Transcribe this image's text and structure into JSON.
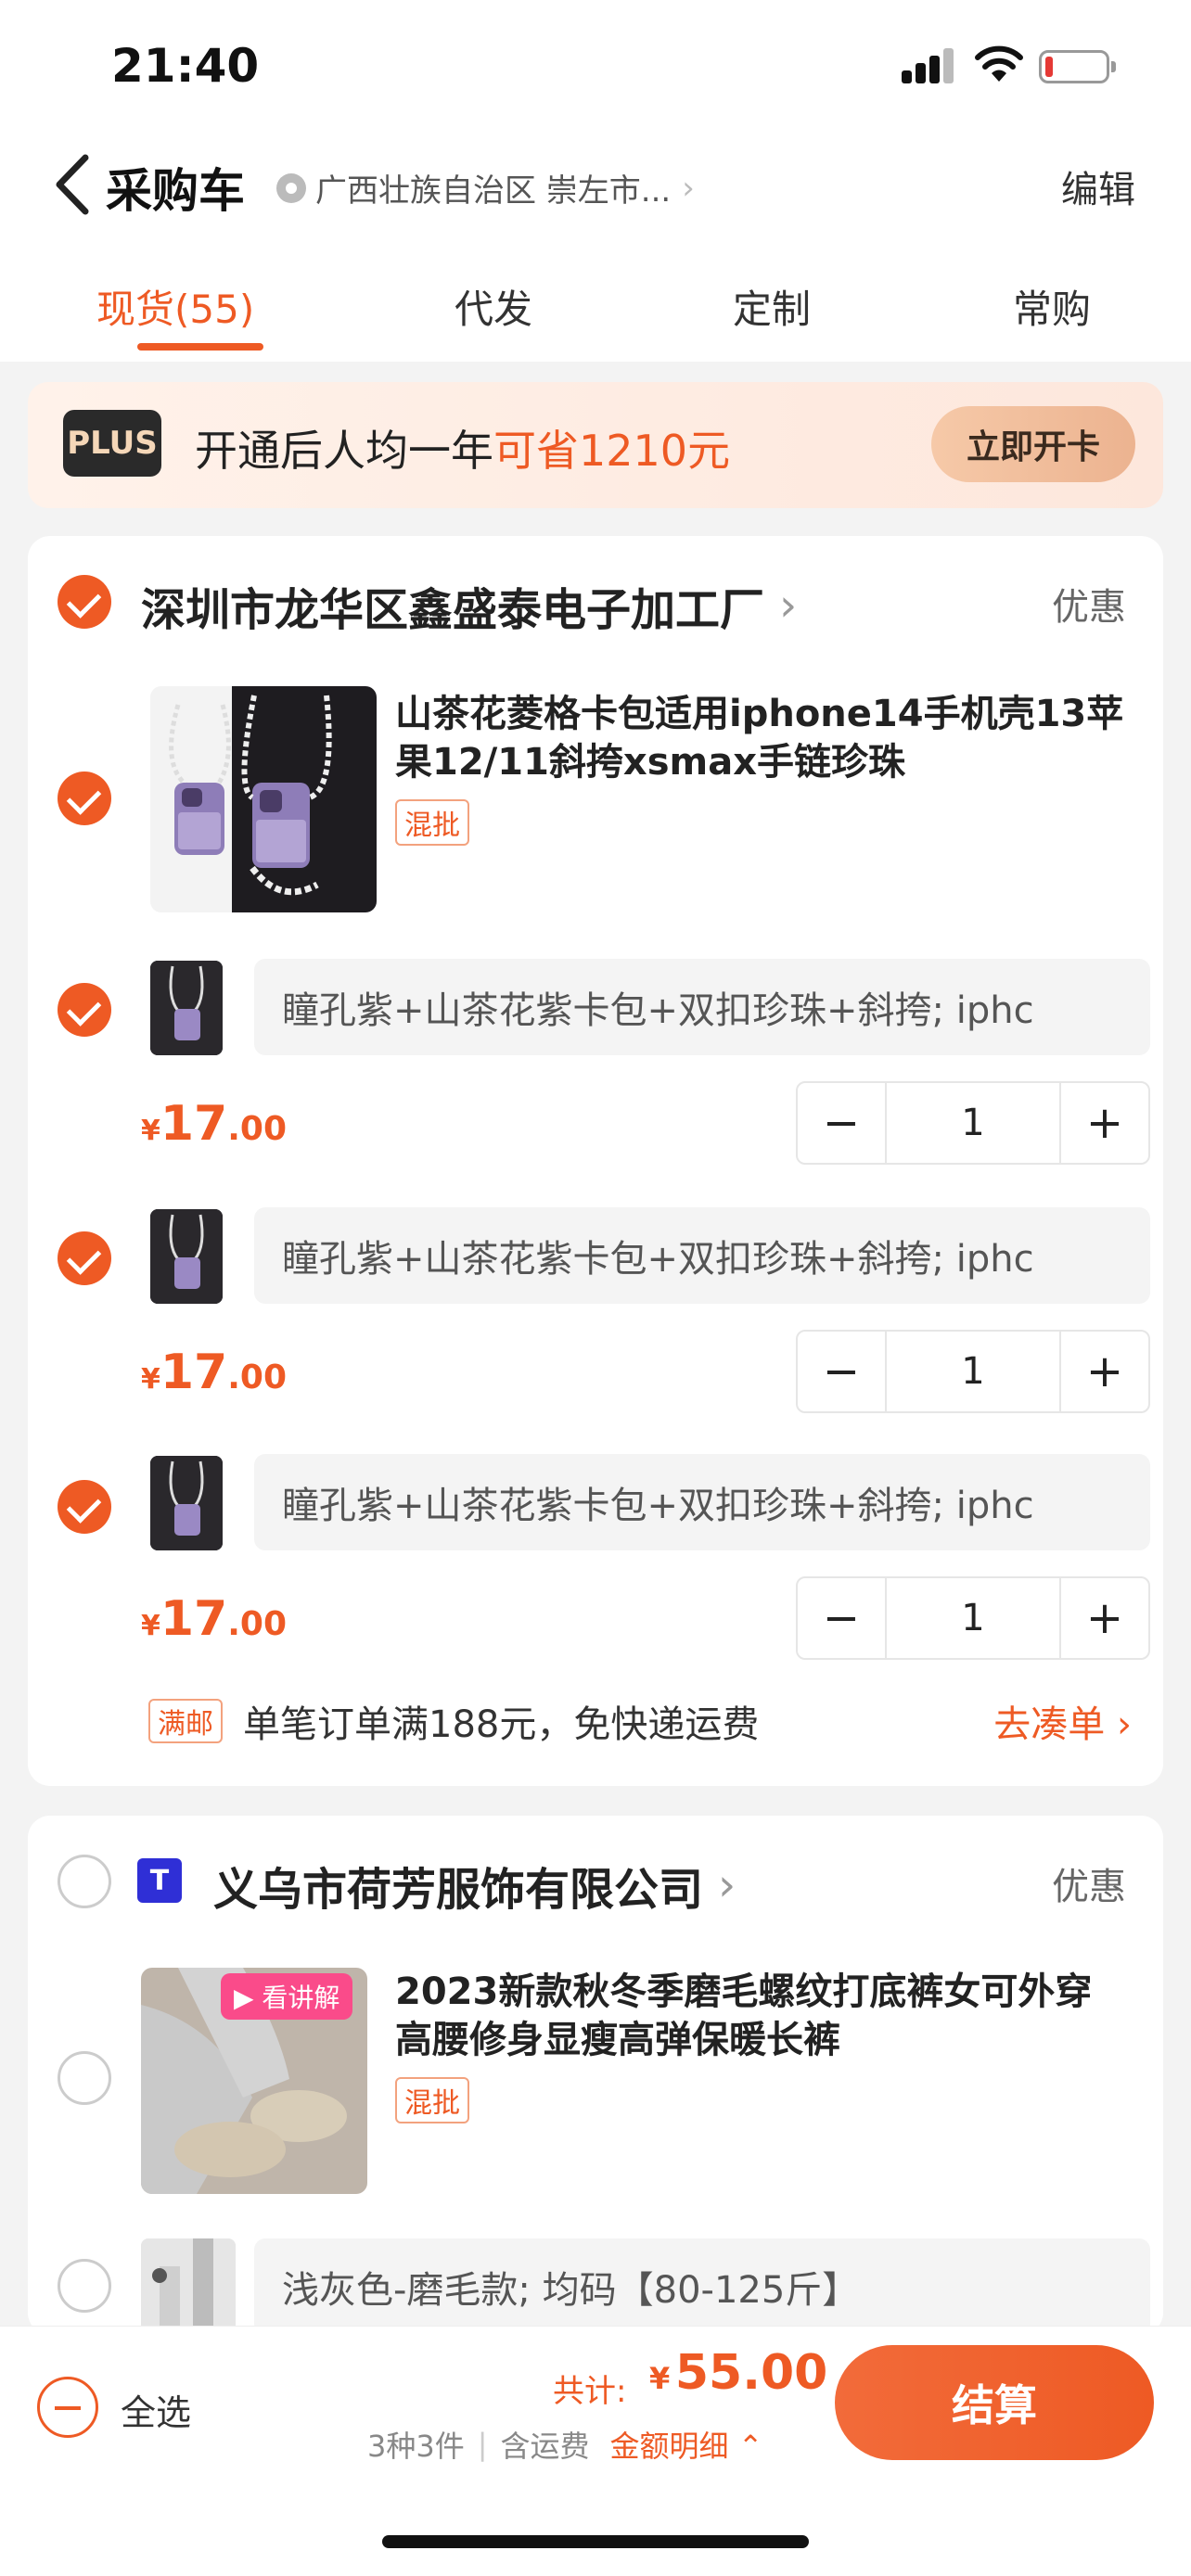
{
  "status_bar": {
    "time": "21:40"
  },
  "nav": {
    "title": "采购车",
    "location": "广西壮族自治区 崇左市...",
    "edit": "编辑"
  },
  "tabs": [
    "现货(55)",
    "代发",
    "定制",
    "常购"
  ],
  "plus_banner": {
    "badge": "PLUS",
    "text_prefix": "开通后人均一年",
    "text_highlight": "可省1210元",
    "button": "立即开卡"
  },
  "shop1": {
    "name": "深圳市龙华区鑫盛泰电子加工厂",
    "promo": "优惠",
    "product": {
      "title": "山茶花菱格卡包适用iphone14手机壳13苹果12/11斜挎xsmax手链珍珠",
      "tag": "混批"
    },
    "variants": [
      {
        "spec": "瞳孔紫+山茶花紫卡包+双扣珍珠+斜挎; iphc",
        "price_int": "17",
        "price_dec": ".00",
        "qty": "1"
      },
      {
        "spec": "瞳孔紫+山茶花紫卡包+双扣珍珠+斜挎; iphc",
        "price_int": "17",
        "price_dec": ".00",
        "qty": "1"
      },
      {
        "spec": "瞳孔紫+山茶花紫卡包+双扣珍珠+斜挎; iphc",
        "price_int": "17",
        "price_dec": ".00",
        "qty": "1"
      }
    ],
    "shipping": {
      "tag": "满邮",
      "text": "单笔订单满188元，免快递运费",
      "link": "去凑单 ›"
    }
  },
  "shop2": {
    "name": "义乌市荷芳服饰有限公司",
    "promo": "优惠",
    "product": {
      "title": "2023新款秋冬季磨毛螺纹打底裤女可外穿高腰修身显瘦高弹保暖长裤",
      "tag": "混批",
      "live_badge": "▶ 看讲解"
    },
    "variant": {
      "spec": "浅灰色-磨毛款; 均码【80-125斤】"
    }
  },
  "bottom": {
    "select_all": "全选",
    "total_label": "共计:",
    "currency": "¥",
    "total": "55.00",
    "count": "3种3件",
    "shipping_note": "含运费",
    "detail": "金额明细 ⌃",
    "checkout": "结算"
  },
  "colors": {
    "accent": "#ee5a24",
    "background": "#f3f3f3"
  },
  "currency_symbol": "¥"
}
